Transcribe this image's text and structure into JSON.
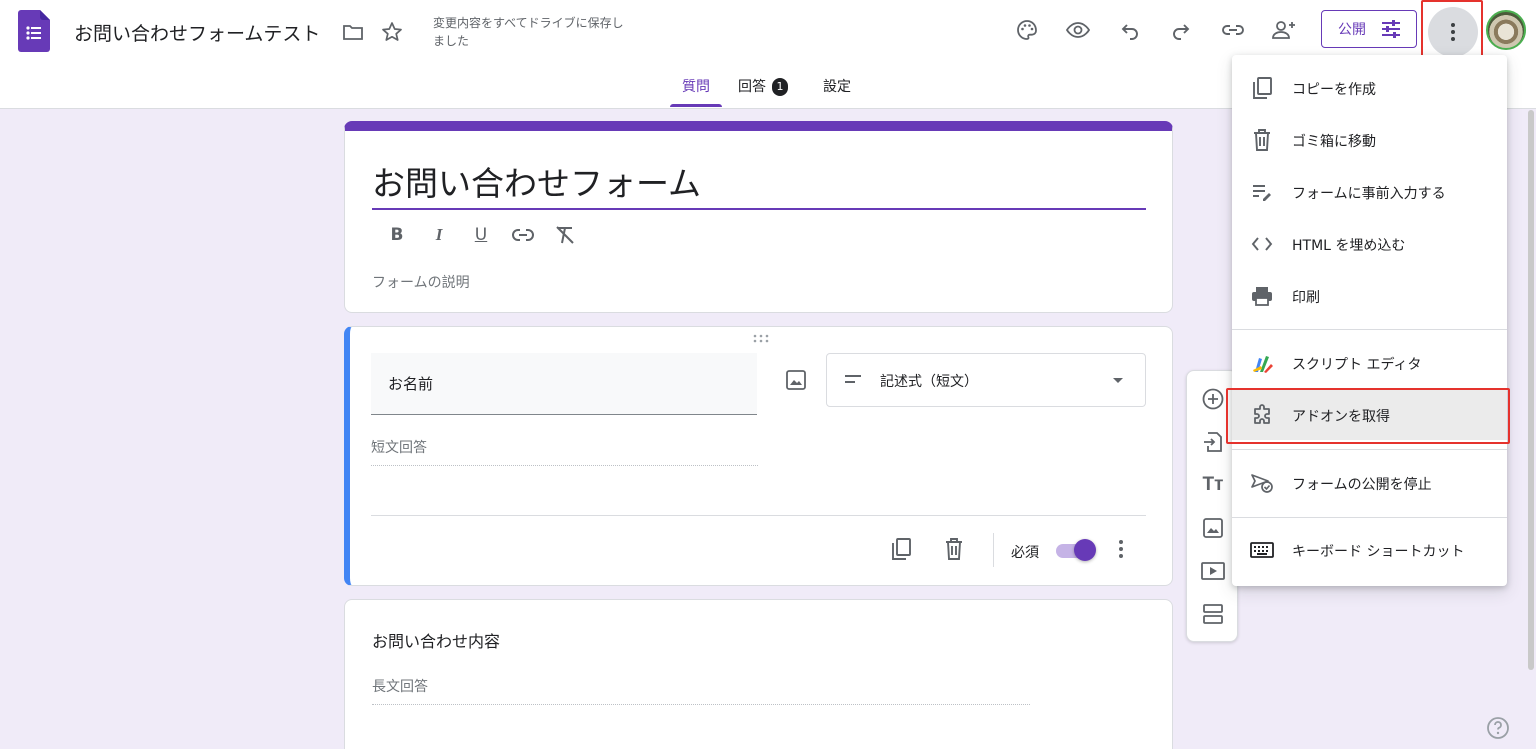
{
  "app": {
    "doc_title": "お問い合わせフォームテスト",
    "save_status": "変更内容をすべてドライブに保存しました",
    "publish_label": "公開",
    "brand_color": "#673ab7",
    "toolbar_icons": [
      "palette-icon",
      "preview-eye-icon",
      "undo-icon",
      "redo-icon",
      "link-icon",
      "add-collaborator-icon"
    ]
  },
  "tabs": [
    {
      "label": "質問",
      "active": true
    },
    {
      "label": "回答",
      "badge": "1"
    },
    {
      "label": "設定"
    }
  ],
  "form": {
    "title": "お問い合わせフォーム",
    "description_placeholder": "フォームの説明",
    "format_buttons": [
      "B",
      "I",
      "U"
    ]
  },
  "question1": {
    "title": "お名前",
    "type": "記述式（短文）",
    "answer_placeholder": "短文回答",
    "required_label": "必須",
    "required": true
  },
  "question2": {
    "title": "お問い合わせ内容",
    "answer_placeholder": "長文回答"
  },
  "menu": {
    "items": [
      {
        "label": "コピーを作成",
        "icon": "copy-icon"
      },
      {
        "label": "ゴミ箱に移動",
        "icon": "trash-icon"
      },
      {
        "label": "フォームに事前入力する",
        "icon": "prefill-icon"
      },
      {
        "label": "HTML を埋め込む",
        "icon": "code-icon"
      },
      {
        "label": "印刷",
        "icon": "print-icon"
      },
      {
        "label": "スクリプト エディタ",
        "icon": "apps-script-icon"
      },
      {
        "label": "アドオンを取得",
        "icon": "puzzle-icon",
        "highlighted": true
      },
      {
        "label": "フォームの公開を停止",
        "icon": "unpublish-icon"
      },
      {
        "label": "キーボード ショートカット",
        "icon": "keyboard-icon"
      }
    ]
  },
  "highlight_color": "#e5322d"
}
